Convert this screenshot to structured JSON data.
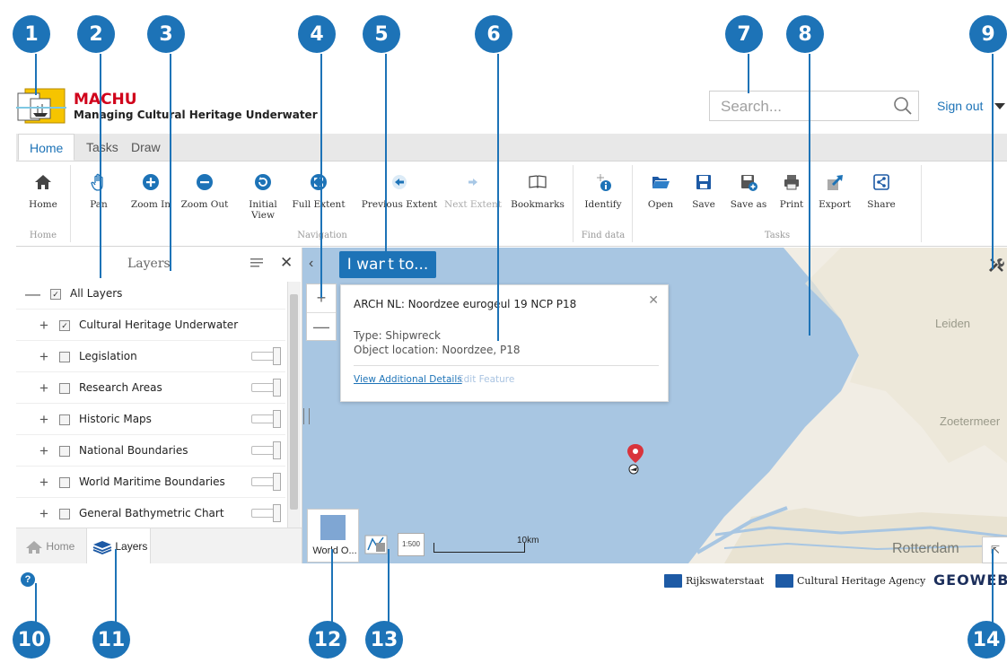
{
  "callouts": [
    "1",
    "2",
    "3",
    "4",
    "5",
    "6",
    "7",
    "8",
    "9",
    "10",
    "11",
    "12",
    "13",
    "14"
  ],
  "header": {
    "title": "MACHU",
    "subtitle": "Managing Cultural Heritage Underwater",
    "search_placeholder": "Search...",
    "sign_out": "Sign out"
  },
  "tabs": [
    {
      "label": "Home",
      "active": true
    },
    {
      "label": "Tasks",
      "active": false
    },
    {
      "label": "Draw",
      "active": false
    }
  ],
  "ribbon": {
    "groups": {
      "home": "Home",
      "navigation": "Navigation",
      "find_data": "Find data",
      "tasks": "Tasks"
    },
    "buttons": {
      "home": "Home",
      "pan": "Pan",
      "zoom_in": "Zoom In",
      "zoom_out": "Zoom Out",
      "initial_view": "Initial View",
      "full_extent": "Full Extent",
      "previous_extent": "Previous Extent",
      "next_extent": "Next Extent",
      "bookmarks": "Bookmarks",
      "identify": "Identify",
      "open": "Open",
      "save": "Save",
      "save_as": "Save as",
      "print": "Print",
      "export": "Export",
      "share": "Share"
    }
  },
  "layers": {
    "title": "Layers",
    "all_layers": "All Layers",
    "items": [
      {
        "label": "Cultural Heritage Underwater",
        "checked": true
      },
      {
        "label": "Legislation",
        "checked": false
      },
      {
        "label": "Research Areas",
        "checked": false
      },
      {
        "label": "Historic Maps",
        "checked": false
      },
      {
        "label": "National Boundaries",
        "checked": false
      },
      {
        "label": "World Maritime Boundaries",
        "checked": false
      },
      {
        "label": "General Bathymetric Chart",
        "checked": false
      }
    ]
  },
  "bottom_tabs": {
    "home": "Home",
    "layers": "Layers"
  },
  "map": {
    "i_want_to": "I want to...",
    "popup": {
      "title": "ARCH NL: Noordzee eurogeul 19 NCP P18",
      "type": "Type: Shipwreck",
      "location": "Object location: Noordzee, P18",
      "view_details": "View Additional Details",
      "edit_feature": "Edit Feature"
    },
    "cities": {
      "leiden": "Leiden",
      "zoetermeer": "Zoetermeer",
      "rotterdam": "Rotterdam"
    },
    "basemap_label": "World O...",
    "scale_button": "1:500",
    "scale_label": "10km"
  },
  "footer": {
    "rijkswaterstaat": "Rijkswaterstaat",
    "cultural_heritage_agency": "Cultural Heritage Agency",
    "geoweb": "GEOWEB"
  },
  "colors": {
    "accent": "#1d73b7",
    "brand_red": "#d0021b",
    "sea": "#a8c6e2",
    "land": "#f1ede4"
  }
}
